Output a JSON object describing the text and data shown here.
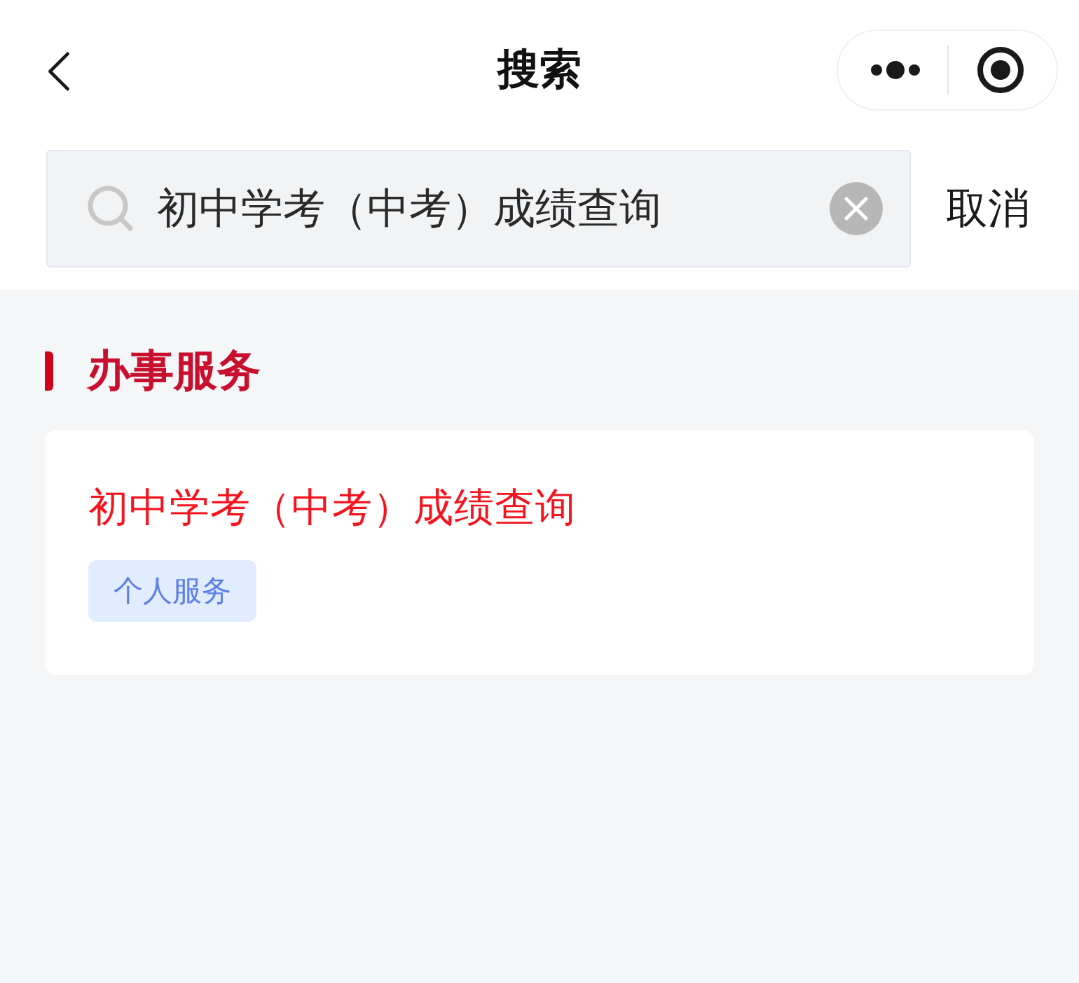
{
  "nav_bar": {
    "title": "搜索"
  },
  "search": {
    "value": "初中学考（中考）成绩查询",
    "cancel": "取消"
  },
  "sections": [
    {
      "title": "办事服务",
      "results": [
        {
          "title": "初中学考（中考）成绩查询",
          "tags": [
            "个人服务"
          ]
        }
      ]
    }
  ]
}
